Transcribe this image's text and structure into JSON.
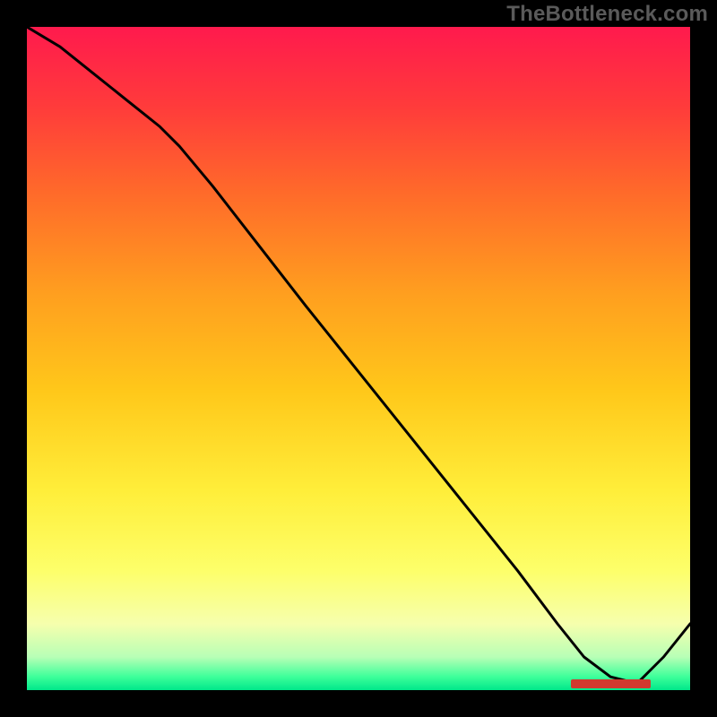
{
  "watermark": "TheBottleneck.com",
  "chart_data": {
    "type": "line",
    "title": "",
    "xlabel": "",
    "ylabel": "",
    "xlim": [
      0,
      100
    ],
    "ylim": [
      0,
      100
    ],
    "x": [
      0,
      5,
      10,
      15,
      20,
      23,
      28,
      35,
      42,
      50,
      58,
      66,
      74,
      80,
      84,
      88,
      92,
      96,
      100
    ],
    "values": [
      100,
      97,
      93,
      89,
      85,
      82,
      76,
      67,
      58,
      48,
      38,
      28,
      18,
      10,
      5,
      2,
      1,
      5,
      10
    ],
    "minimum_band": {
      "x_start": 82,
      "x_end": 94,
      "y": 1
    },
    "background_gradient": {
      "top": "#ff1a4d",
      "mid_upper": "#ff9e1f",
      "mid_lower": "#ffee3a",
      "bottom": "#00e78a"
    },
    "notes": "Single black curve over a vertical red→yellow→green gradient; short red dashed marker band near the curve's minimum at the lower right."
  }
}
